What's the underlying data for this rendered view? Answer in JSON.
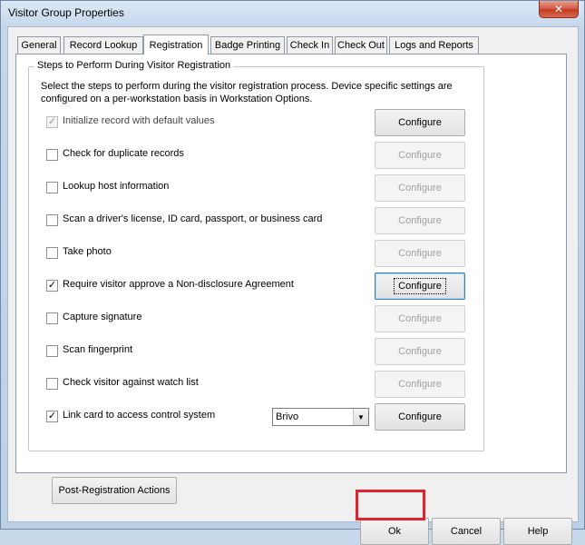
{
  "window": {
    "title": "Visitor Group Properties",
    "close_glyph": "✕"
  },
  "tabs": [
    {
      "label": "General"
    },
    {
      "label": "Record Lookup"
    },
    {
      "label": "Registration"
    },
    {
      "label": "Badge Printing"
    },
    {
      "label": "Check In"
    },
    {
      "label": "Check Out"
    },
    {
      "label": "Logs and Reports"
    }
  ],
  "group": {
    "title": "Steps to Perform During Visitor Registration",
    "description": "Select the steps to perform during the visitor registration process. Device specific settings are configured on a per-workstation basis in Workstation Options."
  },
  "steps": [
    {
      "label": "Initialize record with default values",
      "checked": true,
      "checkbox_disabled": true,
      "button": "Configure",
      "button_enabled": true
    },
    {
      "label": "Check for duplicate records",
      "checked": false,
      "button": "Configure",
      "button_enabled": false
    },
    {
      "label": "Lookup host information",
      "checked": false,
      "button": "Configure",
      "button_enabled": false
    },
    {
      "label": "Scan a driver's license, ID card, passport, or business card",
      "checked": false,
      "button": "Configure",
      "button_enabled": false
    },
    {
      "label": "Take photo",
      "checked": false,
      "button": "Configure",
      "button_enabled": false
    },
    {
      "label": "Require visitor approve a Non-disclosure Agreement",
      "checked": true,
      "button": "Configure",
      "button_enabled": true,
      "focused": true
    },
    {
      "label": "Capture signature",
      "checked": false,
      "button": "Configure",
      "button_enabled": false
    },
    {
      "label": "Scan fingerprint",
      "checked": false,
      "button": "Configure",
      "button_enabled": false
    },
    {
      "label": "Check visitor against watch list",
      "checked": false,
      "button": "Configure",
      "button_enabled": false
    },
    {
      "label": "Link card to access control system",
      "checked": true,
      "button": "Configure",
      "button_enabled": true,
      "dropdown_value": "Brivo"
    }
  ],
  "post_registration_button": "Post-Registration Actions",
  "footer": {
    "ok": "Ok",
    "cancel": "Cancel",
    "help": "Help"
  },
  "colors": {
    "highlight": "#e0242e"
  }
}
